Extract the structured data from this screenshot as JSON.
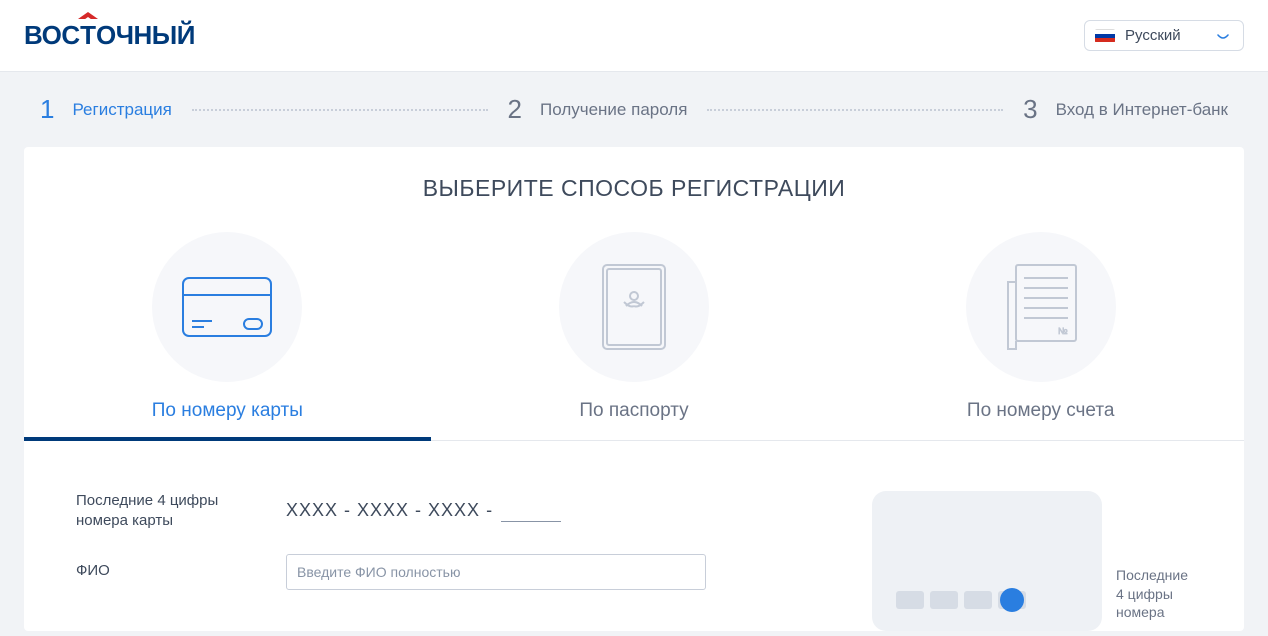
{
  "header": {
    "logo_text": "ВОСТОЧНЫЙ",
    "language": "Русский"
  },
  "steps": [
    {
      "num": "1",
      "label": "Регистрация",
      "active": true
    },
    {
      "num": "2",
      "label": "Получение пароля",
      "active": false
    },
    {
      "num": "3",
      "label": "Вход в Интернет-банк",
      "active": false
    }
  ],
  "title": "ВЫБЕРИТЕ СПОСОБ РЕГИСТРАЦИИ",
  "methods": [
    {
      "label": "По номеру карты",
      "active": true
    },
    {
      "label": "По паспорту",
      "active": false
    },
    {
      "label": "По номеру счета",
      "active": false
    }
  ],
  "form": {
    "card_label": "Последние 4 цифры номера карты",
    "card_mask": "XXXX - XXXX - XXXX -",
    "fio_label": "ФИО",
    "fio_placeholder": "Введите ФИО полностью"
  },
  "hint": {
    "line1": "Последние",
    "line2": "4 цифры номера"
  }
}
